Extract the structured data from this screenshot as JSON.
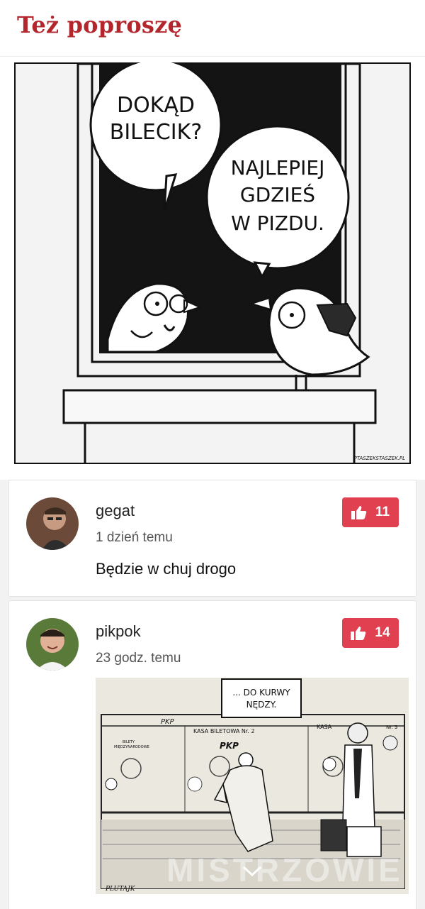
{
  "page": {
    "title": "Też poproszę"
  },
  "post": {
    "image": {
      "bubble1": [
        "DOKĄD",
        "BILECIK?"
      ],
      "bubble2": [
        "NAJLEPIEJ",
        "GDZIEŚ",
        "W PIZDU."
      ],
      "credit": "PTASZEKSTASZEK.PL"
    }
  },
  "comments": [
    {
      "username": "gegat",
      "time": "1 dzień temu",
      "text": "Będzie w chuj drogo",
      "likes": "11"
    },
    {
      "username": "pikpok",
      "time": "23 godz. temu",
      "likes": "14",
      "image": {
        "bubble": [
          "... DO KURWY",
          "NĘDZY."
        ],
        "sign_left": "PKP",
        "sign_mid": "KASA BILETOWA Nr. 2",
        "sign_right": "KASA",
        "sign_right2": "Nr. 3",
        "sign_center": "PKP",
        "small_sign": [
          "BILETY",
          "MIĘDZYNARODOWE"
        ],
        "watermark": "MISTRZOWIE",
        "signature": "PLUTAJK"
      }
    }
  ],
  "colors": {
    "accent": "#b3262c",
    "like": "#e0404f"
  }
}
